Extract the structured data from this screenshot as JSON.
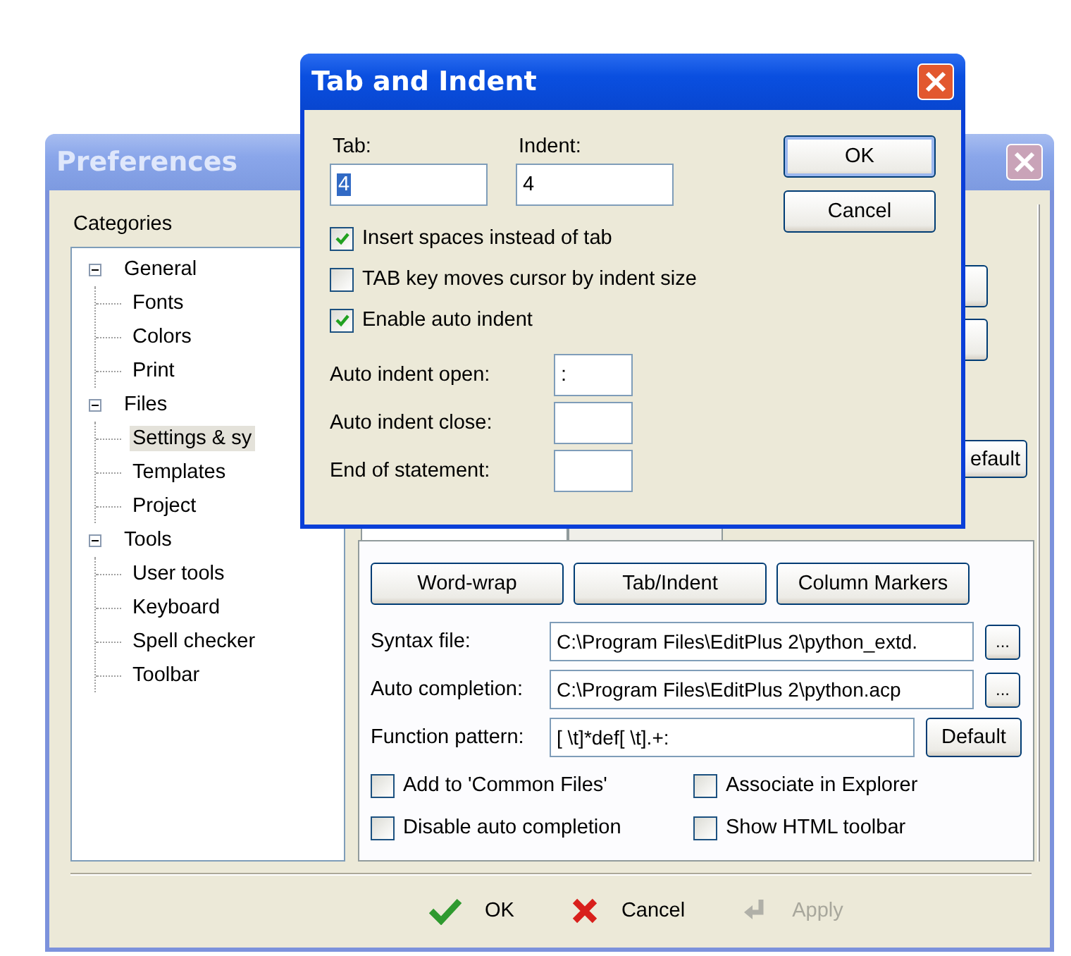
{
  "preferences": {
    "title": "Preferences",
    "active": false,
    "categories_label": "Categories",
    "tree": [
      {
        "label": "General",
        "expanded": true,
        "selected": false,
        "children": [
          {
            "label": "Fonts",
            "selected": false
          },
          {
            "label": "Colors",
            "selected": false
          },
          {
            "label": "Print",
            "selected": false
          }
        ]
      },
      {
        "label": "Files",
        "expanded": true,
        "selected": false,
        "children": [
          {
            "label": "Settings & sy",
            "selected": true
          },
          {
            "label": "Templates",
            "selected": false
          },
          {
            "label": "Project",
            "selected": false
          }
        ]
      },
      {
        "label": "Tools",
        "expanded": true,
        "selected": false,
        "children": [
          {
            "label": "User tools",
            "selected": false
          },
          {
            "label": "Keyboard",
            "selected": false
          },
          {
            "label": "Spell checker",
            "selected": false
          },
          {
            "label": "Toolbar",
            "selected": false
          }
        ]
      }
    ],
    "partial_button": "efault",
    "tabs": [
      {
        "selected": true
      },
      {
        "selected": false
      }
    ],
    "tab_buttons": [
      "Word-wrap",
      "Tab/Indent",
      "Column Markers"
    ],
    "fields": [
      {
        "label": "Syntax file:",
        "value": "C:\\Program Files\\EditPlus 2\\python_extd.",
        "kind": "browse",
        "button": "..."
      },
      {
        "label": "Auto completion:",
        "value": "C:\\Program Files\\EditPlus 2\\python.acp",
        "kind": "browse",
        "button": "..."
      },
      {
        "label": "Function pattern:",
        "value": "[ \\t]*def[ \\t].+:",
        "kind": "default",
        "button": "Default"
      }
    ],
    "options": [
      {
        "label": "Add to 'Common Files'",
        "checked": false
      },
      {
        "label": "Associate in Explorer",
        "checked": false
      },
      {
        "label": "Disable auto completion",
        "checked": false
      },
      {
        "label": "Show HTML toolbar",
        "checked": false
      }
    ],
    "buttons": [
      {
        "label": "OK",
        "kind": "ok",
        "disabled": false
      },
      {
        "label": "Cancel",
        "kind": "cancel",
        "disabled": false
      },
      {
        "label": "Apply",
        "kind": "apply",
        "disabled": true
      }
    ]
  },
  "dialog": {
    "title": "Tab and Indent",
    "active": true,
    "tab": {
      "label": "Tab:",
      "value": "4"
    },
    "indent": {
      "label": "Indent:",
      "value": "4"
    },
    "checks": [
      {
        "label": "Insert spaces instead of tab",
        "checked": true
      },
      {
        "label": "TAB key moves cursor by indent size",
        "checked": false
      },
      {
        "label": "Enable auto indent",
        "checked": true
      }
    ],
    "fields": [
      {
        "label": "Auto indent open:",
        "value": ":"
      },
      {
        "label": "Auto indent close:"
      },
      {
        "label": "End of statement:"
      }
    ],
    "buttons": [
      {
        "label": "OK",
        "default": true
      },
      {
        "label": "Cancel",
        "default": false
      }
    ]
  }
}
